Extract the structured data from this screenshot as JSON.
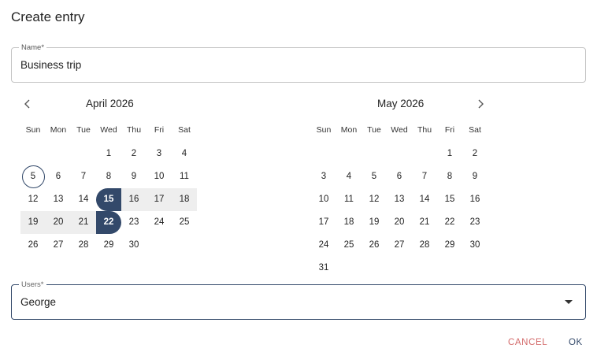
{
  "dialog": {
    "title": "Create entry"
  },
  "name_field": {
    "label": "Name*",
    "value": "Business trip"
  },
  "weekdays": [
    "Sun",
    "Mon",
    "Tue",
    "Wed",
    "Thu",
    "Fri",
    "Sat"
  ],
  "calendars": [
    {
      "month_label": "April 2026",
      "weeks": [
        [
          "",
          "",
          "",
          "1",
          "2",
          "3",
          "4"
        ],
        [
          "5",
          "6",
          "7",
          "8",
          "9",
          "10",
          "11"
        ],
        [
          "12",
          "13",
          "14",
          "15",
          "16",
          "17",
          "18"
        ],
        [
          "19",
          "20",
          "21",
          "22",
          "23",
          "24",
          "25"
        ],
        [
          "26",
          "27",
          "28",
          "29",
          "30",
          "",
          ""
        ]
      ]
    },
    {
      "month_label": "May 2026",
      "weeks": [
        [
          "",
          "",
          "",
          "",
          "",
          "1",
          "2"
        ],
        [
          "3",
          "4",
          "5",
          "6",
          "7",
          "8",
          "9"
        ],
        [
          "10",
          "11",
          "12",
          "13",
          "14",
          "15",
          "16"
        ],
        [
          "17",
          "18",
          "19",
          "20",
          "21",
          "22",
          "23"
        ],
        [
          "24",
          "25",
          "26",
          "27",
          "28",
          "29",
          "30"
        ],
        [
          "31",
          "",
          "",
          "",
          "",
          "",
          ""
        ]
      ]
    }
  ],
  "selection": {
    "today": "5",
    "range_start": "15",
    "range_end": "22",
    "month": "April 2026"
  },
  "nav": {
    "prev_icon": "chevron-left-icon",
    "next_icon": "chevron-right-icon"
  },
  "users_field": {
    "label": "Users*",
    "value": "George",
    "icon": "caret-down-icon"
  },
  "buttons": {
    "cancel": "CANCEL",
    "ok": "OK"
  },
  "colors": {
    "accent": "#33496a",
    "range_fill": "#eeeeee",
    "cancel": "#d36a6a"
  }
}
